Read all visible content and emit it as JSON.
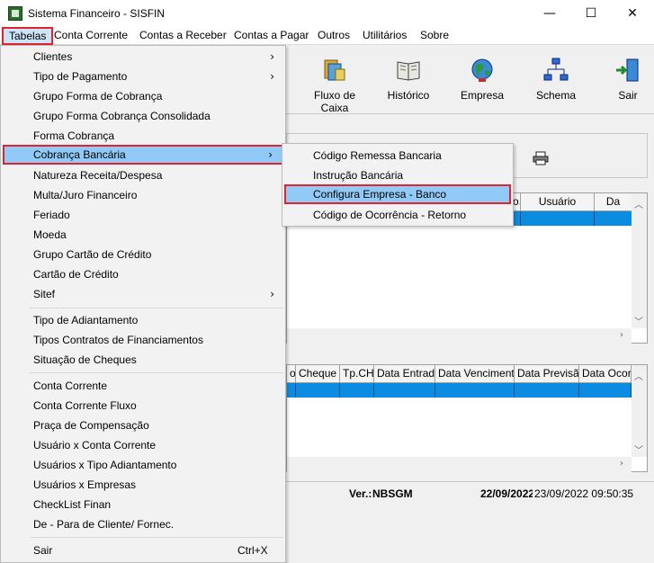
{
  "window": {
    "title": "Sistema Financeiro - SISFIN",
    "minimize": "—",
    "maximize": "☐",
    "close": "✕"
  },
  "menubar": [
    "Tabelas",
    "Conta Corrente",
    "Contas a Receber",
    "Contas a Pagar",
    "Outros",
    "Utilitários",
    "Sobre"
  ],
  "tabelas_menu": [
    {
      "label": "Clientes",
      "submenu": true
    },
    {
      "label": "Tipo de Pagamento",
      "submenu": true
    },
    {
      "label": "Grupo Forma de Cobrança"
    },
    {
      "label": "Grupo Forma Cobrança Consolidada"
    },
    {
      "label": "Forma Cobrança"
    },
    {
      "label": "Cobrança Bancária",
      "submenu": true,
      "selected": true
    },
    {
      "label": "Natureza Receita/Despesa"
    },
    {
      "label": "Multa/Juro Financeiro"
    },
    {
      "label": "Feriado"
    },
    {
      "label": "Moeda"
    },
    {
      "label": "Grupo Cartão de Crédito"
    },
    {
      "label": "Cartão de Crédito"
    },
    {
      "label": "Sitef",
      "submenu": true
    },
    {
      "label": "Tipo de Adiantamento"
    },
    {
      "label": "Tipos Contratos de Financiamentos"
    },
    {
      "label": "Situação de Cheques"
    },
    {
      "label": "Conta Corrente"
    },
    {
      "label": "Conta Corrente Fluxo"
    },
    {
      "label": "Praça de Compensação"
    },
    {
      "label": "Usuário x Conta Corrente"
    },
    {
      "label": "Usuários x Tipo Adiantamento"
    },
    {
      "label": "Usuários x Empresas"
    },
    {
      "label": "CheckList Finan"
    },
    {
      "label": "De - Para de Cliente/ Fornec."
    },
    {
      "label": "Sair",
      "shortcut": "Ctrl+X"
    }
  ],
  "cobranca_submenu": [
    {
      "label": "Código Remessa Bancaria"
    },
    {
      "label": "Instrução Bancária"
    },
    {
      "label": "Configura Empresa - Banco",
      "selected": true
    },
    {
      "label": "Código de Ocorrência - Retorno"
    }
  ],
  "toolbar": [
    {
      "label": "Fluxo de Caixa",
      "icon": "cash-flow-icon"
    },
    {
      "label": "Histórico",
      "icon": "book-icon"
    },
    {
      "label": "Empresa",
      "icon": "globe-icon"
    },
    {
      "label": "Schema",
      "icon": "schema-icon"
    },
    {
      "label": "Sair",
      "icon": "exit-door-icon"
    }
  ],
  "grid1": {
    "headers": [
      "o.",
      "Usuário",
      "Da"
    ]
  },
  "grid2": {
    "headers": [
      "o",
      "Cheque",
      "Tp.CH",
      "Data Entrada",
      "Data Vencimento",
      "Data Previsão",
      "Data Ocorrê"
    ]
  },
  "status": {
    "ver_label": "Ver.:",
    "ver_value": "NBSGM",
    "date_bold": "22/09/2022",
    "datetime": "23/09/2022 09:50:35"
  },
  "arrows": {
    "right": "›",
    "up": "︿",
    "down": "﹀",
    "left": "‹"
  },
  "colors": {
    "highlight_border": "#e0242f",
    "menu_highlight": "#91c9f7",
    "grid_selection": "#0a8ce0"
  }
}
